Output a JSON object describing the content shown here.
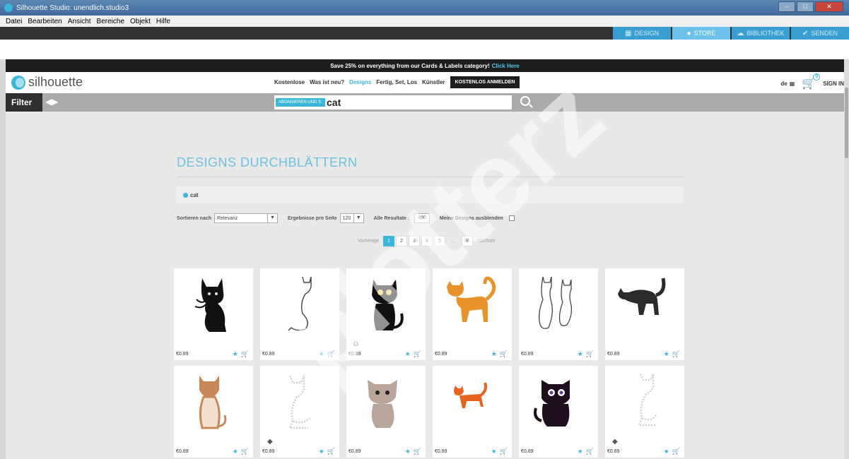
{
  "window": {
    "title": "Silhouette Studio: unendlich.studio3"
  },
  "menu": [
    "Datei",
    "Bearbeiten",
    "Ansicht",
    "Bereiche",
    "Objekt",
    "Hilfe"
  ],
  "app_tabs": [
    {
      "label": "Design",
      "icon": "grid-icon"
    },
    {
      "label": "Store",
      "icon": "silhouette-icon"
    },
    {
      "label": "Bibliothek",
      "icon": "cloud-icon"
    },
    {
      "label": "Senden",
      "icon": "check-icon"
    }
  ],
  "promo": {
    "text": "Save 25% on everything from our Cards & Labels category!",
    "link": "Click Here"
  },
  "header": {
    "logo": "silhouette",
    "nav": [
      "Kostenlose",
      "Was ist neu?",
      "Designs",
      "Fertig, Set, Los",
      "Künstler"
    ],
    "signup": "KOSTENLOS ANMELDEN",
    "lang": "de",
    "cart_count": "0",
    "signin": "SIGN IN"
  },
  "filter": {
    "label": "Filter"
  },
  "search": {
    "tag": "ABONNIEREN UND S",
    "value": "cat"
  },
  "main": {
    "title": "DESIGNS DURCHBLÄTTERN",
    "active_tag": "cat",
    "sort_label": "Sortieren nach",
    "sort_value": "Relevanz",
    "per_page_label": "Ergebnisse pro Seite",
    "per_page_value": "120",
    "total_label": "Alle Resultate :",
    "total_value": "880",
    "hide_label": "Meine Designs ausblenden"
  },
  "pager": {
    "prev": "Vorherige",
    "pages": [
      "1",
      "2",
      "3",
      "4",
      "5"
    ],
    "dots": "…",
    "last": "8",
    "next": "Nächste"
  },
  "products": [
    {
      "price": "€0.89"
    },
    {
      "price": "€0.89"
    },
    {
      "price": "€0.89"
    },
    {
      "price": "€0.89"
    },
    {
      "price": "€0.89"
    },
    {
      "price": "€0.89"
    },
    {
      "price": "€0.89"
    },
    {
      "price": "€0.89"
    },
    {
      "price": "€0.89"
    },
    {
      "price": "€0.89"
    },
    {
      "price": "€0.89"
    },
    {
      "price": "€0.89"
    }
  ],
  "colors": {
    "accent": "#3cb6d9",
    "dark": "#1d1d1d",
    "cat_orange": "#e8932a"
  },
  "watermark": "plotterz"
}
